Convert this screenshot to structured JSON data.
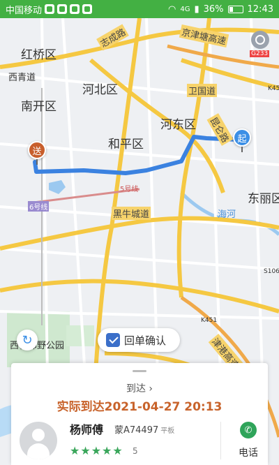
{
  "status_bar": {
    "carrier": "中国移动",
    "network": "4G",
    "battery": "36%",
    "time": "12:43"
  },
  "map": {
    "districts": [
      "红桥区",
      "河北区",
      "南开区",
      "河东区",
      "和平区",
      "东丽区"
    ],
    "places": [
      "西青道",
      "西青郊野公园"
    ],
    "roads": [
      "志成路",
      "京津塘高速",
      "卫国道",
      "昆仑路",
      "黑牛城道",
      "津港高速"
    ],
    "shields": [
      "G233",
      "K451",
      "S106",
      "K451"
    ],
    "metro_labels": [
      "5号线",
      "6号线"
    ],
    "water": "海河",
    "start_label": "起",
    "end_label": "送",
    "route_color": "#3b82e0"
  },
  "actions": {
    "confirm_label": "回单确认"
  },
  "trip_card": {
    "arrive_link": "到达",
    "arrive_time": "实际到达2021-04-27 20:13",
    "driver_name": "杨师傅",
    "plate": "蒙A74497",
    "plate_type": "平板",
    "stars": "★★★★★",
    "rating": "5",
    "phone_label": "电话"
  },
  "colors": {
    "status_bar": "#43b043",
    "accent_orange": "#c8632b",
    "accent_green": "#2fa45a",
    "route_blue": "#3b82e0"
  }
}
